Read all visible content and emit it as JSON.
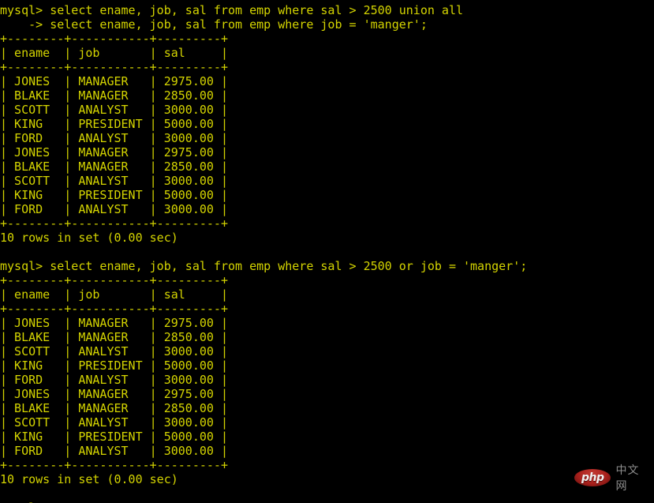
{
  "terminal": {
    "prompt": "mysql>",
    "continuation_prompt": "->",
    "foreground_color": "#d4d400",
    "background_color": "#000000",
    "lines": [
      "mysql> select ename, job, sal from emp where sal > 2500 union all",
      "    -> select ename, job, sal from emp where job = 'manger';",
      "+--------+-----------+---------+",
      "| ename  | job       | sal     |",
      "+--------+-----------+---------+",
      "| JONES  | MANAGER   | 2975.00 |",
      "| BLAKE  | MANAGER   | 2850.00 |",
      "| SCOTT  | ANALYST   | 3000.00 |",
      "| KING   | PRESIDENT | 5000.00 |",
      "| FORD   | ANALYST   | 3000.00 |",
      "| JONES  | MANAGER   | 2975.00 |",
      "| BLAKE  | MANAGER   | 2850.00 |",
      "| SCOTT  | ANALYST   | 3000.00 |",
      "| KING   | PRESIDENT | 5000.00 |",
      "| FORD   | ANALYST   | 3000.00 |",
      "+--------+-----------+---------+",
      "10 rows in set (0.00 sec)",
      "",
      "mysql> select ename, job, sal from emp where sal > 2500 or job = 'manger';",
      "+--------+-----------+---------+",
      "| ename  | job       | sal     |",
      "+--------+-----------+---------+",
      "| JONES  | MANAGER   | 2975.00 |",
      "| BLAKE  | MANAGER   | 2850.00 |",
      "| SCOTT  | ANALYST   | 3000.00 |",
      "| KING   | PRESIDENT | 5000.00 |",
      "| FORD   | ANALYST   | 3000.00 |",
      "| JONES  | MANAGER   | 2975.00 |",
      "| BLAKE  | MANAGER   | 2850.00 |",
      "| SCOTT  | ANALYST   | 3000.00 |",
      "| KING   | PRESIDENT | 5000.00 |",
      "| FORD   | ANALYST   | 3000.00 |",
      "+--------+-----------+---------+",
      "10 rows in set (0.00 sec)",
      "",
      "mysql>"
    ],
    "queries": [
      {
        "statement_lines": [
          "select ename, job, sal from emp where sal > 2500 union all",
          "select ename, job, sal from emp where job = 'manger';"
        ],
        "columns": [
          "ename",
          "job",
          "sal"
        ],
        "rows": [
          [
            "JONES",
            "MANAGER",
            "2975.00"
          ],
          [
            "BLAKE",
            "MANAGER",
            "2850.00"
          ],
          [
            "SCOTT",
            "ANALYST",
            "3000.00"
          ],
          [
            "KING",
            "PRESIDENT",
            "5000.00"
          ],
          [
            "FORD",
            "ANALYST",
            "3000.00"
          ],
          [
            "JONES",
            "MANAGER",
            "2975.00"
          ],
          [
            "BLAKE",
            "MANAGER",
            "2850.00"
          ],
          [
            "SCOTT",
            "ANALYST",
            "3000.00"
          ],
          [
            "KING",
            "PRESIDENT",
            "5000.00"
          ],
          [
            "FORD",
            "ANALYST",
            "3000.00"
          ]
        ],
        "result_status": "10 rows in set (0.00 sec)"
      },
      {
        "statement_lines": [
          "select ename, job, sal from emp where sal > 2500 or job = 'manger';"
        ],
        "columns": [
          "ename",
          "job",
          "sal"
        ],
        "rows": [
          [
            "JONES",
            "MANAGER",
            "2975.00"
          ],
          [
            "BLAKE",
            "MANAGER",
            "2850.00"
          ],
          [
            "SCOTT",
            "ANALYST",
            "3000.00"
          ],
          [
            "KING",
            "PRESIDENT",
            "5000.00"
          ],
          [
            "FORD",
            "ANALYST",
            "3000.00"
          ],
          [
            "JONES",
            "MANAGER",
            "2975.00"
          ],
          [
            "BLAKE",
            "MANAGER",
            "2850.00"
          ],
          [
            "SCOTT",
            "ANALYST",
            "3000.00"
          ],
          [
            "KING",
            "PRESIDENT",
            "5000.00"
          ],
          [
            "FORD",
            "ANALYST",
            "3000.00"
          ]
        ],
        "result_status": "10 rows in set (0.00 sec)"
      }
    ]
  },
  "watermark": {
    "badge_text": "php",
    "site_text": "中文网",
    "badge_color": "#a8201c",
    "site_text_color": "#8d8d8d"
  }
}
